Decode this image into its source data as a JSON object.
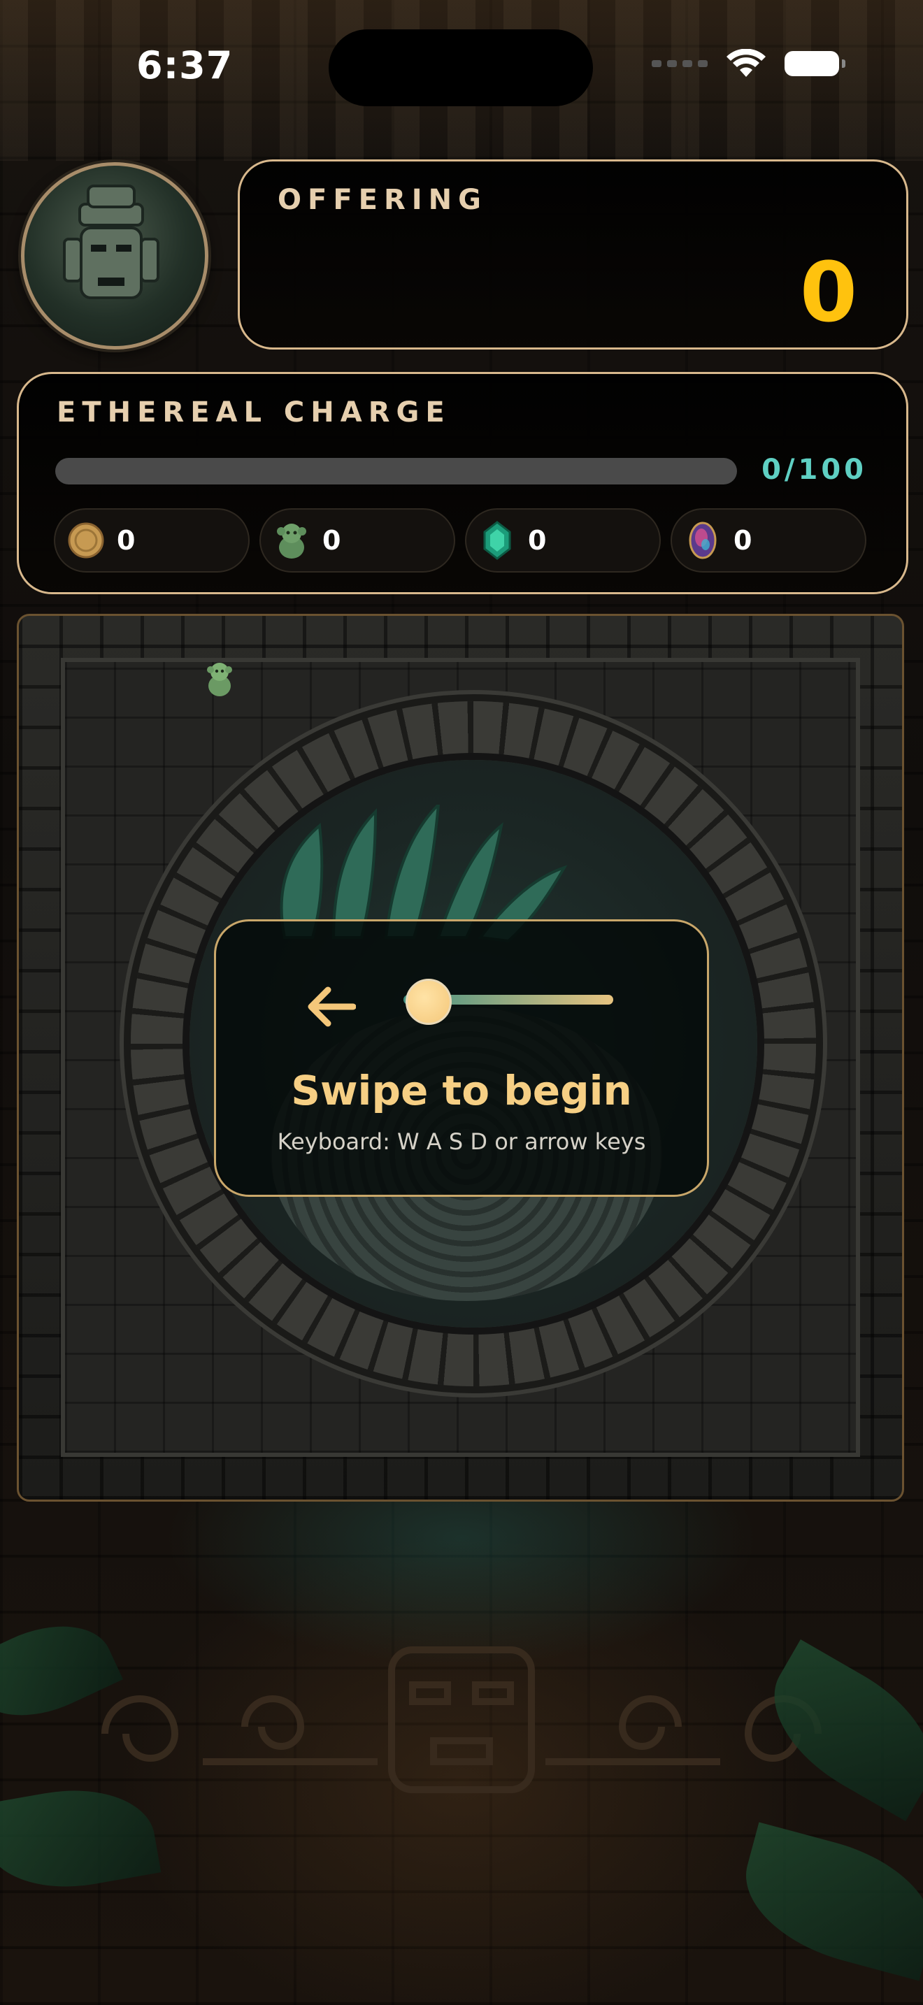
{
  "status_bar": {
    "time": "6:37"
  },
  "hud": {
    "offering": {
      "label": "OFFERING",
      "value": "0"
    },
    "ethereal_charge": {
      "label": "ETHEREAL CHARGE",
      "progress_text": "0/100",
      "progress_fraction": 0,
      "resources": [
        {
          "icon": "gold-coin-icon",
          "count": "0"
        },
        {
          "icon": "jade-monkey-icon",
          "count": "0"
        },
        {
          "icon": "emerald-gem-icon",
          "count": "0"
        },
        {
          "icon": "opal-gem-icon",
          "count": "0"
        }
      ]
    }
  },
  "hint": {
    "title": "Swipe to begin",
    "subtitle": "Keyboard: W A S D or arrow keys"
  },
  "colors": {
    "accent_gold": "#ffc20e",
    "charge_teal": "#5fd0c3",
    "panel_border": "#d8b88c",
    "hint_title": "#f6cf84"
  }
}
